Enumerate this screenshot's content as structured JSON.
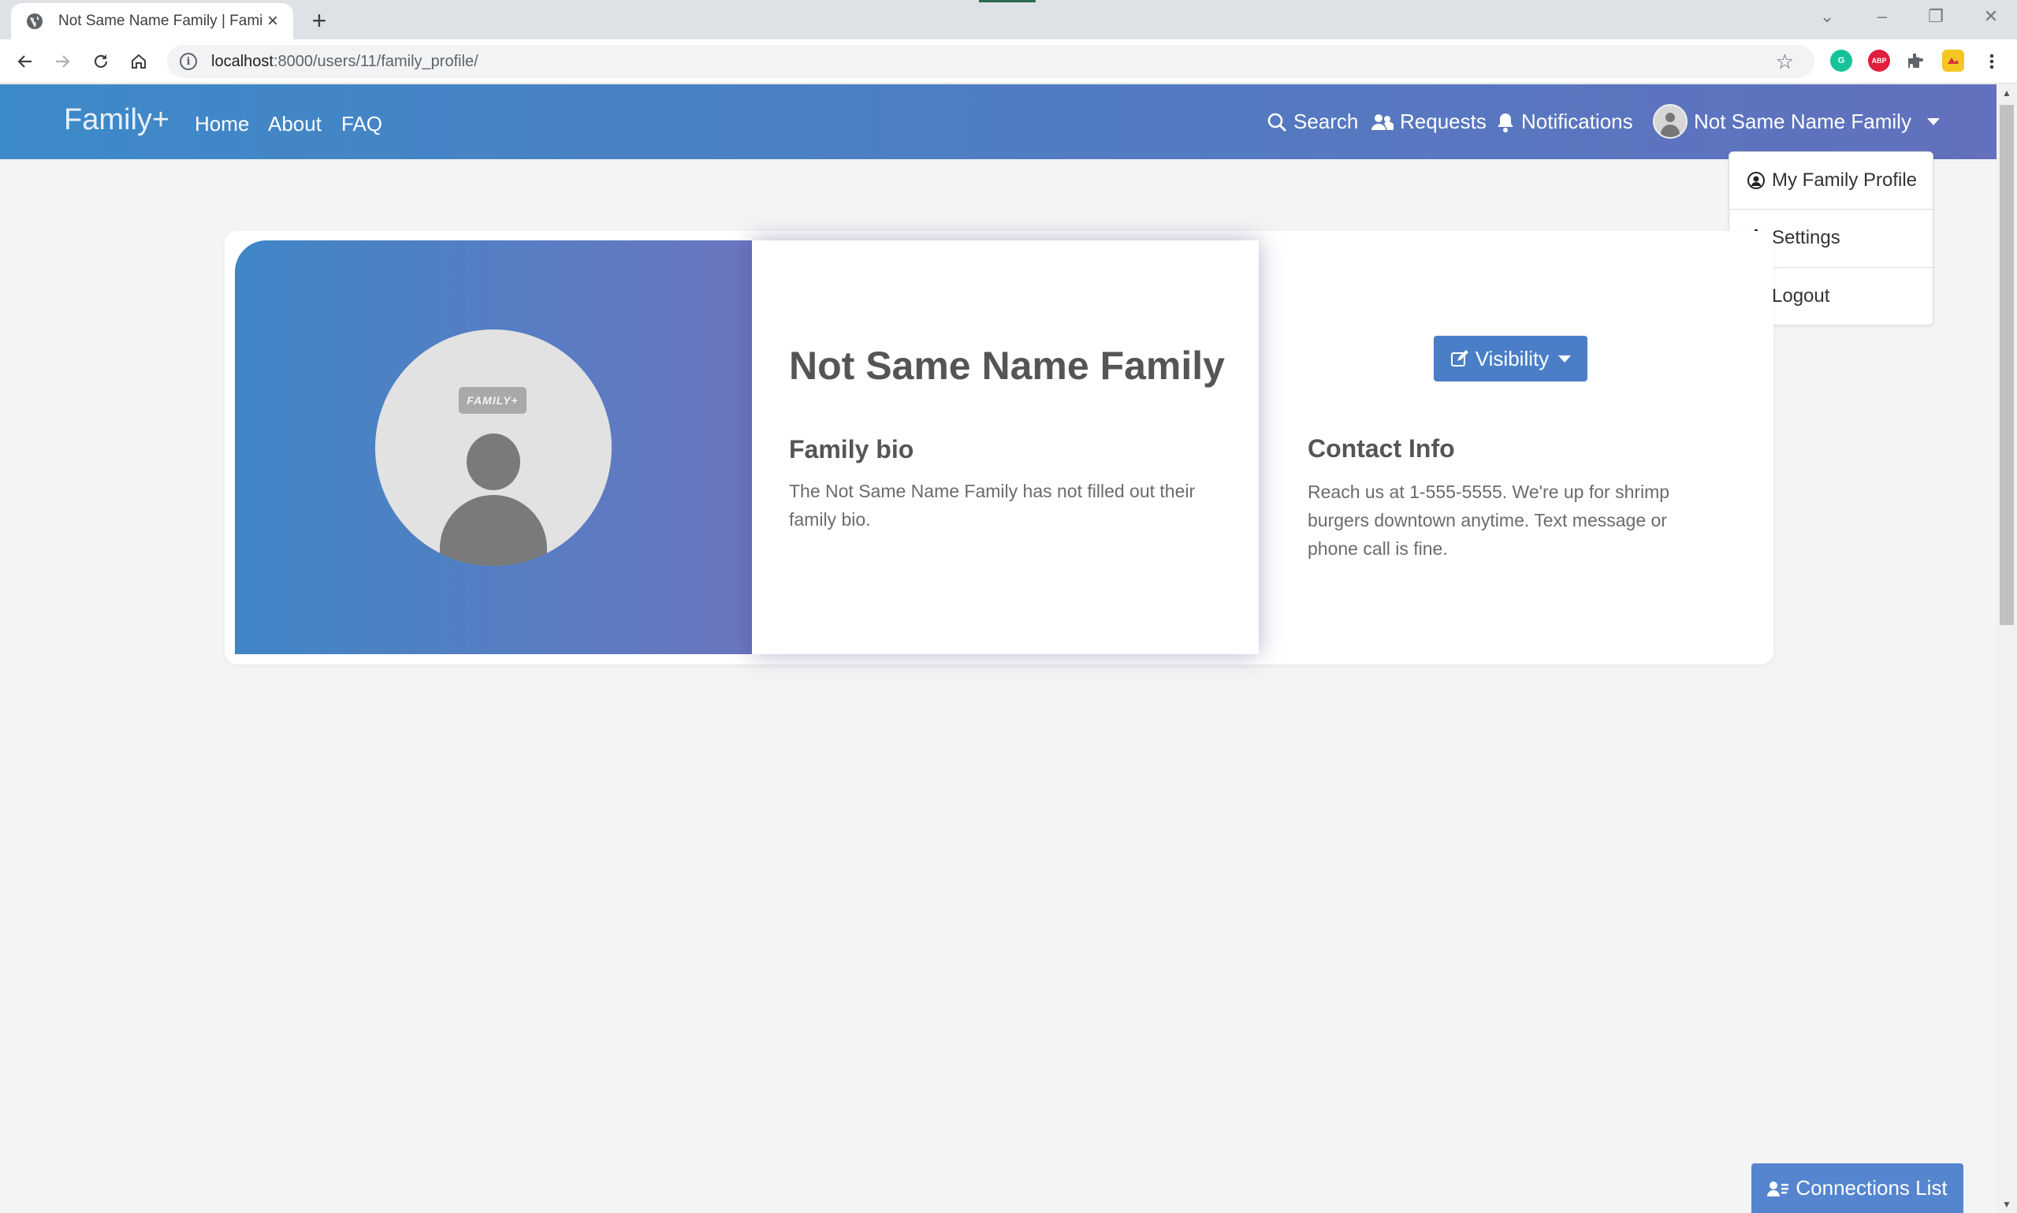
{
  "browser": {
    "tab_title": "Not Same Name Family | Family+",
    "url_host": "localhost",
    "url_path": ":8000/users/11/family_profile/",
    "extensions": [
      "grammarly-icon",
      "adblock-plus-icon",
      "extensions-puzzle-icon",
      "extension-custom-icon"
    ],
    "abp_label": "ABP"
  },
  "navbar": {
    "brand": "Family+",
    "links": [
      "Home",
      "About",
      "FAQ"
    ],
    "search": "Search",
    "requests": "Requests",
    "notifications": "Notifications",
    "user": "Not Same Name Family"
  },
  "dropdown": {
    "items": [
      "My Family Profile",
      "Settings",
      "Logout"
    ]
  },
  "profile": {
    "avatar_tag": "FAMILY+",
    "name": "Not Same Name Family",
    "bio_heading": "Family bio",
    "bio_text": "The Not Same Name Family has not filled out their family bio.",
    "visibility_button": "Visibility",
    "contact_heading": "Contact Info",
    "contact_text": "Reach us at 1-555-5555. We're up for shrimp burgers downtown anytime. Text message or phone call is fine."
  },
  "connections_button": "Connections List",
  "colors": {
    "navbar_start": "#3d8ac8",
    "navbar_end": "#6270bd",
    "button_blue": "#4a7fc8",
    "page_bg": "#f4f4f4"
  }
}
